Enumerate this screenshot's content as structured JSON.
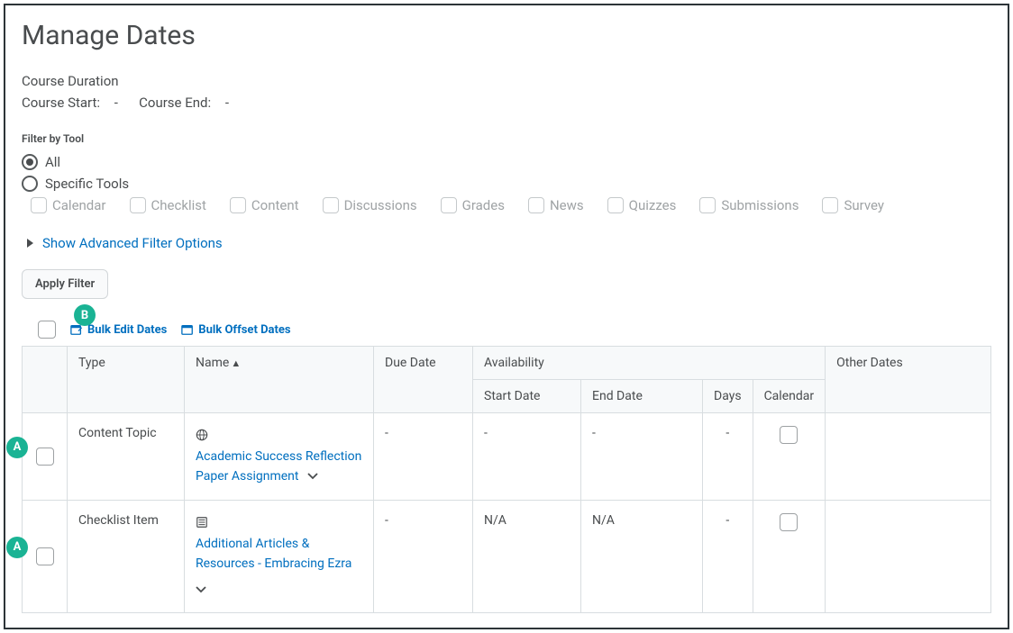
{
  "page_title": "Manage Dates",
  "course_duration_label": "Course Duration",
  "course_start_label": "Course Start:",
  "course_start_value": "-",
  "course_end_label": "Course End:",
  "course_end_value": "-",
  "filter_by_tool_label": "Filter by Tool",
  "radio_all": "All",
  "radio_specific": "Specific Tools",
  "tools": {
    "calendar": "Calendar",
    "checklist": "Checklist",
    "content": "Content",
    "discussions": "Discussions",
    "grades": "Grades",
    "news": "News",
    "quizzes": "Quizzes",
    "submissions": "Submissions",
    "survey": "Survey"
  },
  "advanced_filter_label": "Show Advanced Filter Options",
  "apply_filter_label": "Apply Filter",
  "bulk_edit_label": "Bulk Edit Dates",
  "bulk_offset_label": "Bulk Offset Dates",
  "headers": {
    "type": "Type",
    "name": "Name",
    "due_date": "Due Date",
    "availability": "Availability",
    "start_date": "Start Date",
    "end_date": "End Date",
    "days": "Days",
    "calendar": "Calendar",
    "other_dates": "Other Dates"
  },
  "rows": [
    {
      "type": "Content Topic",
      "name": "Academic Success Reflection Paper Assignment",
      "icon": "globe",
      "due": "-",
      "start": "-",
      "end": "-",
      "days": "-"
    },
    {
      "type": "Checklist Item",
      "name": "Additional Articles & Resources - Embracing Ezra",
      "icon": "list",
      "due": "-",
      "start": "N/A",
      "end": "N/A",
      "days": "-"
    }
  ],
  "annotations": {
    "a": "A",
    "b": "B"
  }
}
